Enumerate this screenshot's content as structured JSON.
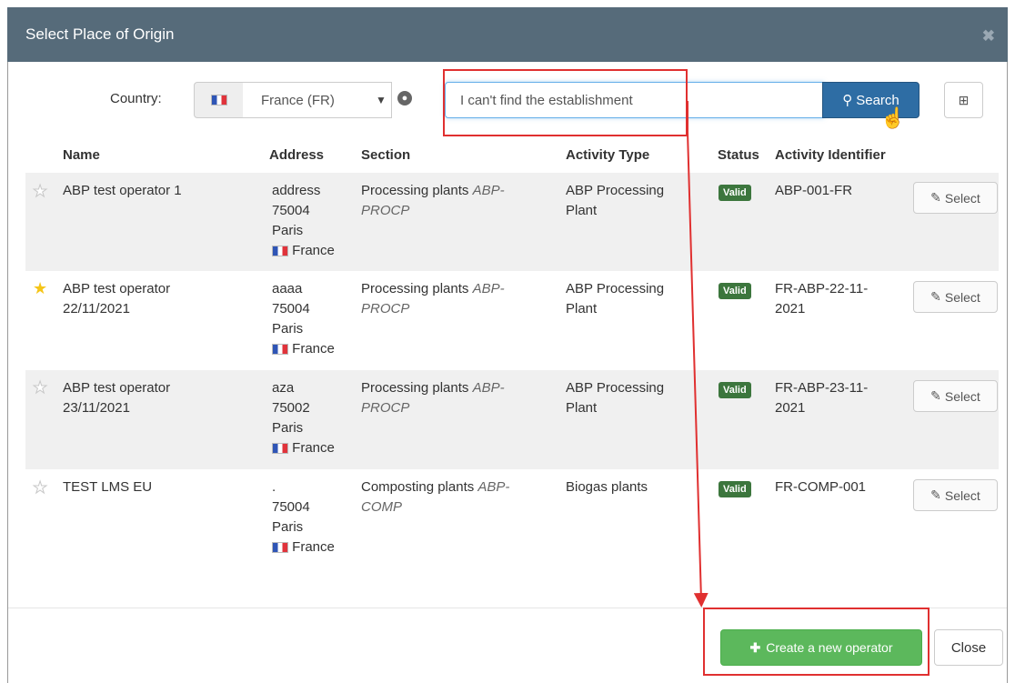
{
  "dialog": {
    "title": "Select Place of Origin",
    "close_icon": "times-icon"
  },
  "toolbar": {
    "country_label": "Country:",
    "country_value": "France (FR)",
    "search_value": "I can't find the establishment",
    "search_label": "Search",
    "expand_icon": "plus-square-icon"
  },
  "table": {
    "headers": [
      "Name",
      "Address",
      "Section",
      "Activity Type",
      "Status",
      "Activity Identifier"
    ],
    "rows": [
      {
        "starred": false,
        "name_line1": "ABP test operator 1",
        "name_line2": "",
        "addr1": "address",
        "addr2": "75004",
        "addr3": "Paris",
        "country": "France",
        "section": "Processing plants",
        "section_code": "ABP-PROCP",
        "activity_line1": "ABP Processing",
        "activity_line2": "Plant",
        "status": "Valid",
        "id_line1": "ABP-001-FR",
        "id_line2": "",
        "select_label": "Select"
      },
      {
        "starred": true,
        "name_line1": "ABP test operator",
        "name_line2": "22/11/2021",
        "addr1": "aaaa",
        "addr2": "75004",
        "addr3": "Paris",
        "country": "France",
        "section": "Processing plants",
        "section_code": "ABP-PROCP",
        "activity_line1": "ABP Processing",
        "activity_line2": "Plant",
        "status": "Valid",
        "id_line1": "FR-ABP-22-11-",
        "id_line2": "2021",
        "select_label": "Select"
      },
      {
        "starred": false,
        "name_line1": "ABP test operator",
        "name_line2": "23/11/2021",
        "addr1": "aza",
        "addr2": "75002",
        "addr3": "Paris",
        "country": "France",
        "section": "Processing plants",
        "section_code": "ABP-PROCP",
        "activity_line1": "ABP Processing",
        "activity_line2": "Plant",
        "status": "Valid",
        "id_line1": "FR-ABP-23-11-",
        "id_line2": "2021",
        "select_label": "Select"
      },
      {
        "starred": false,
        "name_line1": "TEST LMS EU",
        "name_line2": "",
        "addr1": ".",
        "addr2": "75004",
        "addr3": "Paris",
        "country": "France",
        "section": "Composting plants",
        "section_code": "ABP-COMP",
        "activity_line1": "Biogas plants",
        "activity_line2": "",
        "status": "Valid",
        "id_line1": "FR-COMP-001",
        "id_line2": "",
        "select_label": "Select"
      }
    ]
  },
  "footer": {
    "create_label": "Create a new operator",
    "close_label": "Close"
  },
  "colors": {
    "header_bg": "#566b7a",
    "primary": "#2e6da4",
    "success": "#5cb85c",
    "valid_badge": "#3c763d",
    "annotation": "#e03030"
  }
}
